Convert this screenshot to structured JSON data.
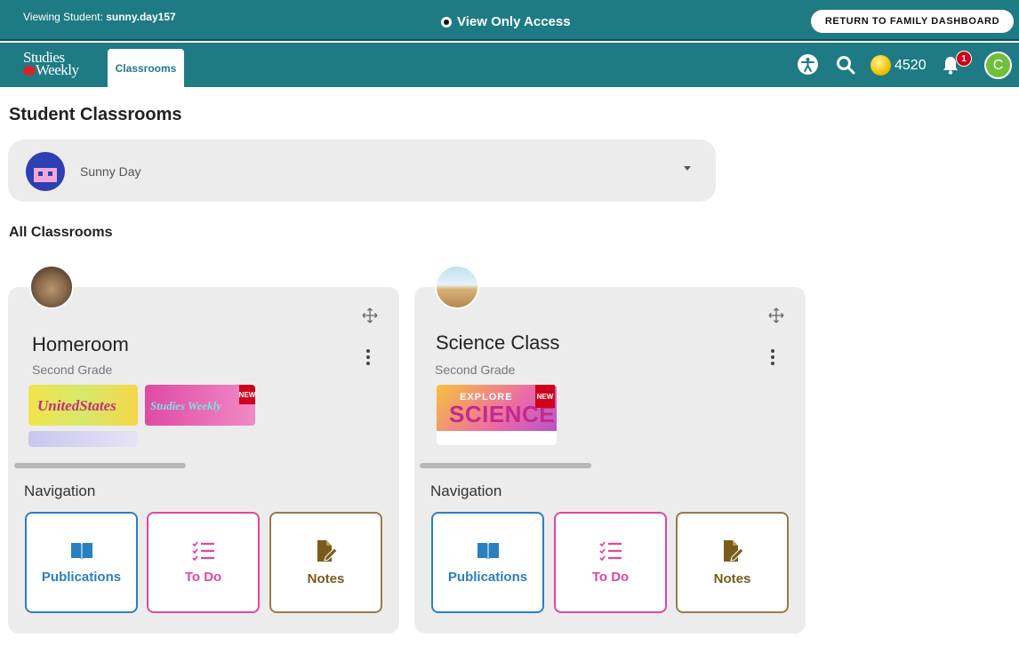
{
  "banner": {
    "viewing_prefix": "Viewing Student:",
    "viewing_username": "sunny.day157",
    "view_only": "View Only Access",
    "return_button": "RETURN TO FAMILY DASHBOARD"
  },
  "navbar": {
    "logo_line1": "Studies",
    "logo_line2": "Weekly",
    "tab_classrooms": "Classrooms",
    "coins": "4520",
    "notification_count": "1",
    "user_initial": "C",
    "accent_color": "#1e7b84"
  },
  "page": {
    "title": "Student Classrooms",
    "all_classrooms": "All Classrooms"
  },
  "student_select": {
    "selected_student": "Sunny Day"
  },
  "classrooms": [
    {
      "name": "Homeroom",
      "grade": "Second Grade",
      "publications": [
        {
          "title": "UnitedStates",
          "icon": "pub-thumbnail"
        },
        {
          "title": "Studies Weekly",
          "badge": "NEW",
          "icon": "pub-thumbnail"
        }
      ],
      "navigation_label": "Navigation",
      "nav": {
        "publications": "Publications",
        "todo": "To Do",
        "notes": "Notes"
      }
    },
    {
      "name": "Science Class",
      "grade": "Second Grade",
      "publications": [
        {
          "title_small": "EXPLORE",
          "title": "SCIENCE",
          "badge": "NEW",
          "icon": "pub-thumbnail"
        }
      ],
      "navigation_label": "Navigation",
      "nav": {
        "publications": "Publications",
        "todo": "To Do",
        "notes": "Notes"
      }
    }
  ]
}
